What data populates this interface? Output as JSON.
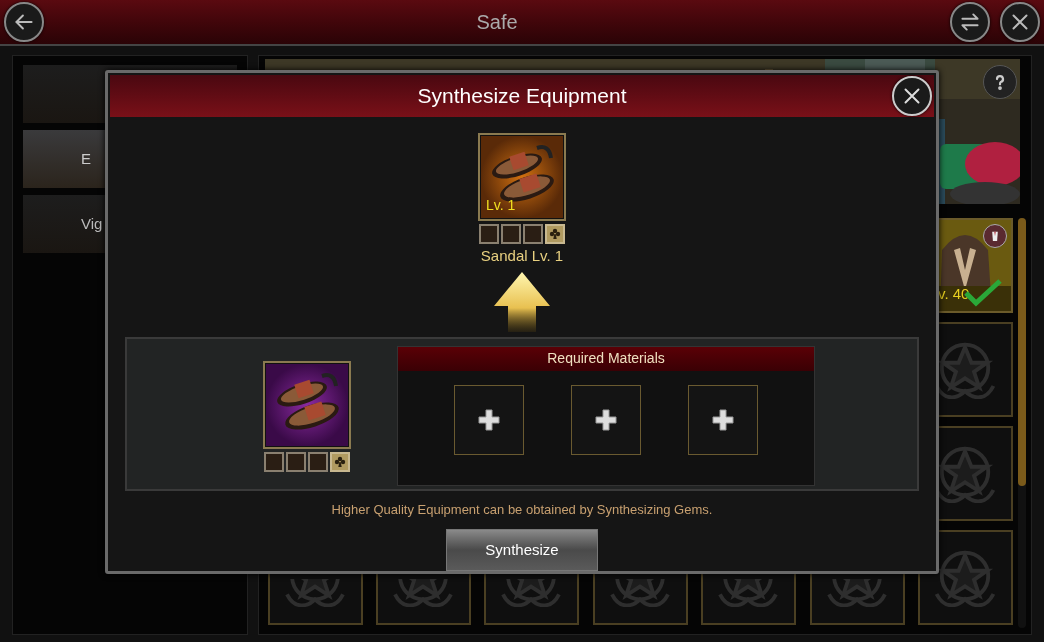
{
  "header": {
    "title": "Safe"
  },
  "sidebar": {
    "items": [
      {
        "selected": false
      },
      {
        "label": "E",
        "selected": true
      },
      {
        "label": "Vig",
        "selected": false
      }
    ]
  },
  "inventory": {
    "slots": [
      {
        "kind": "equipment",
        "level": "v. 40",
        "equipped": true
      },
      {
        "kind": "empty"
      },
      {
        "kind": "empty"
      },
      {
        "kind": "empty"
      },
      {
        "kind": "empty"
      },
      {
        "kind": "empty"
      },
      {
        "kind": "empty"
      },
      {
        "kind": "empty"
      },
      {
        "kind": "empty"
      },
      {
        "kind": "empty"
      }
    ]
  },
  "dialog": {
    "title": "Synthesize Equipment",
    "result": {
      "level": "Lv. 1",
      "name": "Sandal Lv. 1",
      "sockets": [
        {
          "kind": "empty"
        },
        {
          "kind": "empty"
        },
        {
          "kind": "empty"
        },
        {
          "kind": "emblem"
        }
      ]
    },
    "source": {
      "sockets": [
        {
          "kind": "empty"
        },
        {
          "kind": "empty"
        },
        {
          "kind": "empty"
        },
        {
          "kind": "emblem"
        }
      ]
    },
    "materials": {
      "title": "Required Materials",
      "slots": [
        {
          "filled": false
        },
        {
          "filled": false
        },
        {
          "filled": false
        }
      ]
    },
    "hint": "Higher Quality Equipment can be obtained by Synthesizing Gems.",
    "button": "Synthesize"
  }
}
